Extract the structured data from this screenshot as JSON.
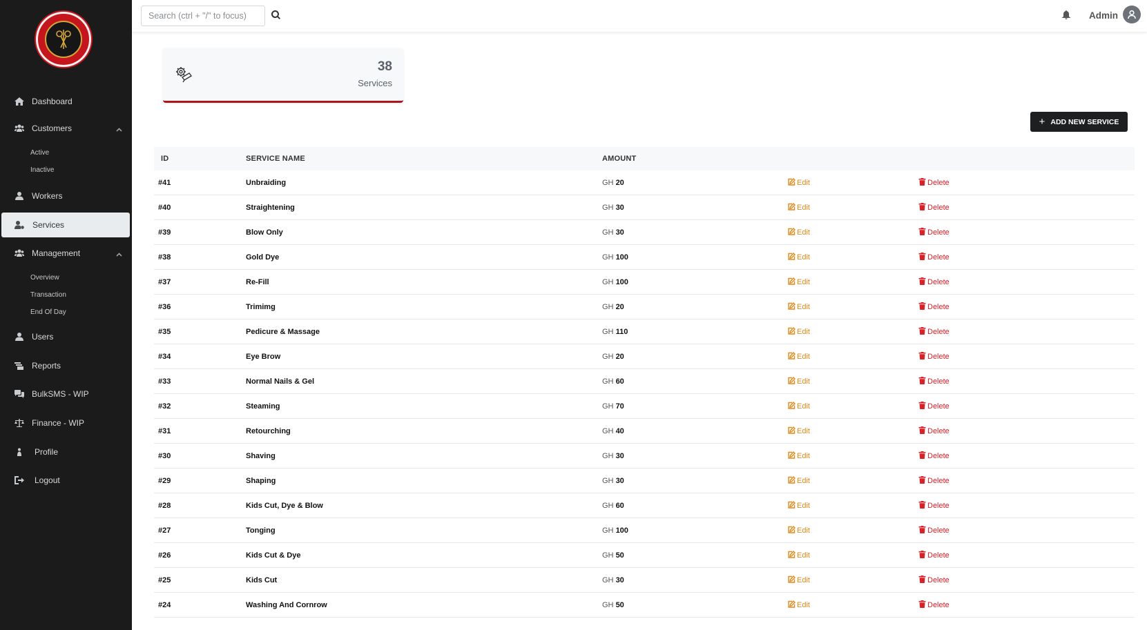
{
  "sidebar": {
    "logo_text": "GENIUS GROOMING PARLOUR UNISEX SALON",
    "items": {
      "dashboard": "Dashboard",
      "customers": "Customers",
      "customers_active": "Active",
      "customers_inactive": "Inactive",
      "workers": "Workers",
      "services": "Services",
      "management": "Management",
      "management_overview": "Overview",
      "management_transaction": "Transaction",
      "management_eod": "End Of Day",
      "users": "Users",
      "reports": "Reports",
      "bulksms": "BulkSMS - WIP",
      "finance": "Finance - WIP",
      "profile": "Profile",
      "logout": "Logout"
    }
  },
  "topbar": {
    "search_placeholder": "Search (ctrl + \"/\" to focus)",
    "user_name": "Admin"
  },
  "stat": {
    "count": "38",
    "label": "Services"
  },
  "add_button_label": "ADD NEW SERVICE",
  "table": {
    "headers": {
      "id": "ID",
      "name": "SERVICE NAME",
      "amount": "AMOUNT"
    },
    "currency": "GH",
    "edit_label": "Edit",
    "delete_label": "Delete",
    "rows": [
      {
        "id": "#41",
        "name": "Unbraiding",
        "amount": "20"
      },
      {
        "id": "#40",
        "name": "Straightening",
        "amount": "30"
      },
      {
        "id": "#39",
        "name": "Blow Only",
        "amount": "30"
      },
      {
        "id": "#38",
        "name": "Gold Dye",
        "amount": "100"
      },
      {
        "id": "#37",
        "name": "Re-Fill",
        "amount": "100"
      },
      {
        "id": "#36",
        "name": "Trimimg",
        "amount": "20"
      },
      {
        "id": "#35",
        "name": "Pedicure & Massage",
        "amount": "110"
      },
      {
        "id": "#34",
        "name": "Eye Brow",
        "amount": "20"
      },
      {
        "id": "#33",
        "name": "Normal Nails & Gel",
        "amount": "60"
      },
      {
        "id": "#32",
        "name": "Steaming",
        "amount": "70"
      },
      {
        "id": "#31",
        "name": "Retourching",
        "amount": "40"
      },
      {
        "id": "#30",
        "name": "Shaving",
        "amount": "30"
      },
      {
        "id": "#29",
        "name": "Shaping",
        "amount": "30"
      },
      {
        "id": "#28",
        "name": "Kids Cut, Dye & Blow",
        "amount": "60"
      },
      {
        "id": "#27",
        "name": "Tonging",
        "amount": "100"
      },
      {
        "id": "#26",
        "name": "Kids Cut & Dye",
        "amount": "50"
      },
      {
        "id": "#25",
        "name": "Kids Cut",
        "amount": "30"
      },
      {
        "id": "#24",
        "name": "Washing And Cornrow",
        "amount": "50"
      }
    ]
  },
  "colors": {
    "sidebar_bg": "#1b1b1b",
    "accent_red": "#b0131c",
    "edit_orange": "#e18a1a",
    "delete_red": "#d92128",
    "button_dark": "#1e1f21"
  }
}
